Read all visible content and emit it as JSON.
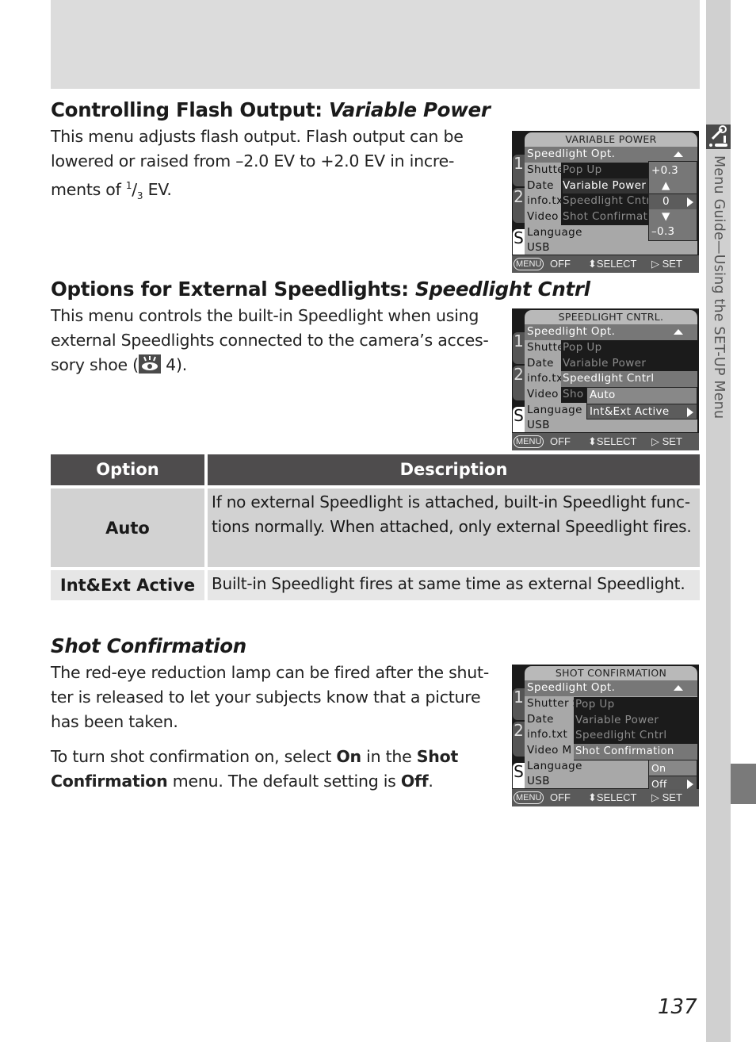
{
  "sidebar": {
    "section_title": "Menu Guide—Using the SET-UP Menu",
    "icon": "setup-wrench-icon"
  },
  "sections": {
    "variable_power": {
      "heading_plain": "Controlling Flash Output: ",
      "heading_italic": "Variable Power",
      "text_1": "This menu adjusts flash output. Flash output can be lowered or raised from –2.0 EV to +2.0 EV in incre- ments of ",
      "fraction_num": "1",
      "fraction_den": "3",
      "text_2": " EV."
    },
    "speedlight_cntrl": {
      "heading_plain": "Options for External Speedlights: ",
      "heading_italic": "Speedlight Cntrl",
      "text_1": "This menu controls the built-in Speedlight when using external Speedlights connected to the camera’s acces- sory shoe (",
      "ref_icon": "eye-reference-icon",
      "text_2": " 4)."
    },
    "shot_confirmation": {
      "heading_italic": "Shot Confirmation",
      "para_1": "The red-eye reduction lamp can be fired after the shut- ter is released to let your subjects know that a picture has been taken.",
      "para_2_a": "To turn shot confirmation on, select ",
      "para_2_b": "On",
      "para_2_c": " in the ",
      "para_2_d": "Shot Confirmation",
      "para_2_e": " menu. The default setting is ",
      "para_2_f": "Off",
      "para_2_g": "."
    }
  },
  "table": {
    "headers": [
      "Option",
      "Description"
    ],
    "rows": [
      {
        "option": "Auto",
        "description": "If no external Speedlight is attached, built-in Speedlight func- tions normally. When attached, only external Speedlight fires."
      },
      {
        "option": "Int&Ext Active",
        "description": "Built-in Speedlight fires at same time as external Speedlight."
      }
    ]
  },
  "screens": {
    "common": {
      "tabs": [
        "1",
        "2",
        "S"
      ],
      "menu_items": [
        "Speedlight Opt.",
        "Shutte",
        "Date",
        "info.tx",
        "Video",
        "Language",
        "USB"
      ],
      "footer": {
        "menu": "MENU",
        "off": "OFF",
        "select": "⬍SELECT",
        "set": "▷ SET"
      }
    },
    "variable_power": {
      "title": "VARIABLE POWER",
      "submenu": [
        "Pop Up",
        "Variable Power",
        "Speedlight Cntr",
        "Shot Confirmat"
      ],
      "values": [
        "+0.3",
        "▲",
        "0",
        "▼",
        "–0.3"
      ]
    },
    "speedlight_cntrl": {
      "title": "SPEEDLIGHT CNTRL.",
      "submenu": [
        "Pop Up",
        "Variable Power",
        "Speedlight Cntrl",
        "Sho"
      ],
      "options": [
        "Auto",
        "Int&Ext Active"
      ]
    },
    "shot_confirmation": {
      "title": "SHOT CONFIRMATION",
      "menu_items": [
        "Speedlight Opt.",
        "Shutter S",
        "Date",
        "info.txt",
        "Video M",
        "Language",
        "USB"
      ],
      "submenu": [
        "Pop Up",
        "Variable Power",
        "Speedlight Cntrl",
        "Shot Confirmation"
      ],
      "options": [
        "On",
        "Off"
      ]
    }
  },
  "page_number": "137"
}
